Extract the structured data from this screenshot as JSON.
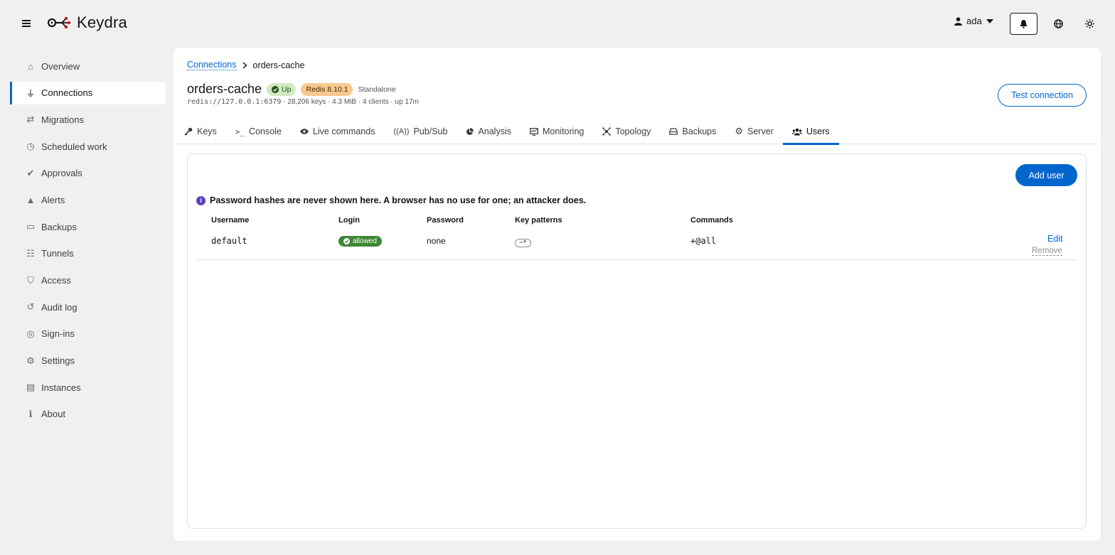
{
  "app": {
    "name": "Keydra"
  },
  "header": {
    "user": "ada"
  },
  "sidebar": {
    "items": [
      {
        "label": "Overview",
        "icon": "home-icon"
      },
      {
        "label": "Connections",
        "icon": "plug-icon",
        "active": true
      },
      {
        "label": "Migrations",
        "icon": "arrows-icon"
      },
      {
        "label": "Scheduled work",
        "icon": "clock-icon"
      },
      {
        "label": "Approvals",
        "icon": "user-check-icon"
      },
      {
        "label": "Alerts",
        "icon": "bell-icon"
      },
      {
        "label": "Backups",
        "icon": "drive-icon"
      },
      {
        "label": "Tunnels",
        "icon": "network-icon"
      },
      {
        "label": "Access",
        "icon": "shield-icon"
      },
      {
        "label": "Audit log",
        "icon": "history-icon"
      },
      {
        "label": "Sign-ins",
        "icon": "fingerprint-icon"
      },
      {
        "label": "Settings",
        "icon": "gear-icon"
      },
      {
        "label": "Instances",
        "icon": "server-icon"
      },
      {
        "label": "About",
        "icon": "info-icon"
      }
    ]
  },
  "breadcrumb": {
    "parent": "Connections",
    "current": "orders-cache"
  },
  "connection": {
    "name": "orders-cache",
    "status": "Up",
    "version": "Redis 8.10.1",
    "mode": "Standalone",
    "address": "redis://127.0.0.1:6379",
    "stats": " · 28,206 keys · 4.3 MiB · 4 clients · up 17m"
  },
  "actions": {
    "test_connection": "Test connection",
    "add_user": "Add user"
  },
  "tabs": [
    {
      "label": "Keys",
      "icon": "key-icon"
    },
    {
      "label": "Console",
      "icon": "terminal-icon"
    },
    {
      "label": "Live commands",
      "icon": "eye-icon"
    },
    {
      "label": "Pub/Sub",
      "icon": "broadcast-icon"
    },
    {
      "label": "Analysis",
      "icon": "pie-icon"
    },
    {
      "label": "Monitoring",
      "icon": "monitor-icon"
    },
    {
      "label": "Topology",
      "icon": "topology-icon"
    },
    {
      "label": "Backups",
      "icon": "drive-icon"
    },
    {
      "label": "Server",
      "icon": "gear-icon"
    },
    {
      "label": "Users",
      "icon": "users-icon",
      "active": true
    }
  ],
  "notice": "Password hashes are never shown here. A browser has no use for one; an attacker does.",
  "table": {
    "headers": [
      "Username",
      "Login",
      "Password",
      "Key patterns",
      "Commands"
    ],
    "rows": [
      {
        "username": "default",
        "login": "allowed",
        "password": "none",
        "key_patterns": "~*",
        "commands": "+@all",
        "edit": "Edit",
        "remove": "Remove"
      }
    ]
  },
  "colors": {
    "accent": "#0066cc",
    "success": "#3e8635",
    "info": "#5e40be"
  }
}
